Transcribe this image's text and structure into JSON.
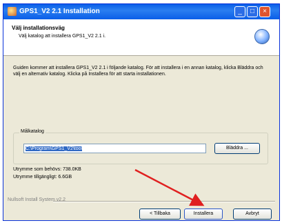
{
  "window": {
    "title": "GPS1_V2 2.1 Installation",
    "min_label": "_",
    "max_label": "□",
    "close_label": "×"
  },
  "header": {
    "title": "Välj installationsväg",
    "subtitle": "Välj katalog att installera GPS1_V2 2.1 i."
  },
  "description": "Guiden kommer att installera GPS1_V2 2.1 i följande katalog. För att installera i en annan katalog, klicka Bläddra och välj en alternativ katalog. Klicka på Installera för att starta installationen.",
  "destination": {
    "group_label": "Målkatalog",
    "path_value": "C:\\Program\\GPS1_V2\\tool",
    "browse_label": "Bläddra ..."
  },
  "space": {
    "required": "Utrymme som behövs: 738.0KB",
    "available": "Utrymme tillgängligt: 6.6GB"
  },
  "footer": {
    "brand": "Nullsoft Install System v2.2",
    "back_label": "< Tillbaka",
    "install_label": "Installera",
    "cancel_label": "Avbryt"
  },
  "colors": {
    "titlebar": "#0a5ee8",
    "arrow": "#e02020",
    "selection": "#316ac5"
  }
}
